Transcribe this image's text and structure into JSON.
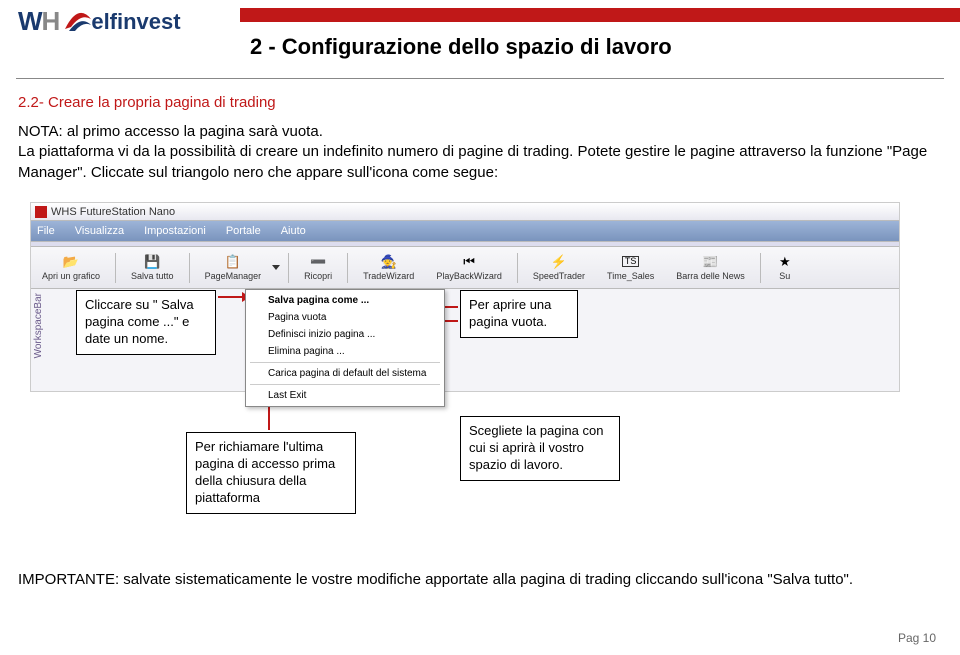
{
  "logo": {
    "brandA": "WH",
    "brandB": " s",
    "brandC": "elfinvest"
  },
  "red_strip": true,
  "title": "2 - Configurazione dello spazio di lavoro",
  "subtitle": "2.2- Creare la propria pagina di trading",
  "body_text": "NOTA: al primo accesso la pagina sarà vuota.\nLa piattaforma vi da la possibilità di creare un indefinito numero di pagine di trading. Potete gestire le pagine attraverso la funzione \"Page Manager\". Cliccate sul triangolo nero che appare sull'icona come segue:",
  "window": {
    "title": "WHS FutureStation Nano",
    "menu": [
      "File",
      "Visualizza",
      "Impostazioni",
      "Portale",
      "Aiuto"
    ],
    "toolbar": [
      {
        "name": "apri-grafico",
        "label": "Apri un grafico",
        "glyph": "📂",
        "sep": true
      },
      {
        "name": "salva-tutto",
        "label": "Salva tutto",
        "glyph": "💾",
        "sep": true
      },
      {
        "name": "page-manager",
        "label": "PageManager",
        "glyph": "📋",
        "sep": false,
        "dropdown": true
      },
      {
        "name": "ricopri",
        "label": "Ricopri",
        "glyph": "➖",
        "sep": true
      },
      {
        "name": "trade-wizard",
        "label": "TradeWizard",
        "glyph": "🧙",
        "sep": false
      },
      {
        "name": "playback-wizard",
        "label": "PlayBackWizard",
        "glyph": "⏮",
        "sep": true
      },
      {
        "name": "speed-trader",
        "label": "SpeedTrader",
        "glyph": "⚡",
        "sep": false
      },
      {
        "name": "time-sales",
        "label": "Time_Sales",
        "glyph": "TS",
        "sep": false
      },
      {
        "name": "barra-news",
        "label": "Barra delle News",
        "glyph": "📰",
        "sep": true
      },
      {
        "name": "su",
        "label": "Su",
        "glyph": "★",
        "sep": false
      }
    ],
    "context_menu": [
      {
        "label": "Salva pagina come ...",
        "bold": true
      },
      {
        "label": "Pagina vuota"
      },
      {
        "label": "Definisci inizio pagina ..."
      },
      {
        "label": "Elimina pagina ..."
      },
      {
        "sep": true
      },
      {
        "label": "Carica pagina di default del sistema"
      },
      {
        "sep": true
      },
      {
        "label": "Last Exit"
      }
    ],
    "sidebar_label": "WorkspaceBar"
  },
  "callouts": {
    "c1": "Cliccare su \" Salva pagina come ...\" e date un nome.",
    "c2": "Per aprire una pagina vuota.",
    "c3": "Per richiamare l'ultima pagina di accesso prima della chiusura della piattaforma",
    "c4": "Scegliete la pagina con cui si aprirà il vostro spazio di lavoro."
  },
  "important": "IMPORTANTE: salvate sistematicamente le vostre modifiche apportate alla pagina di trading cliccando sull'icona \"Salva tutto\".",
  "page_number": "Pag 10"
}
